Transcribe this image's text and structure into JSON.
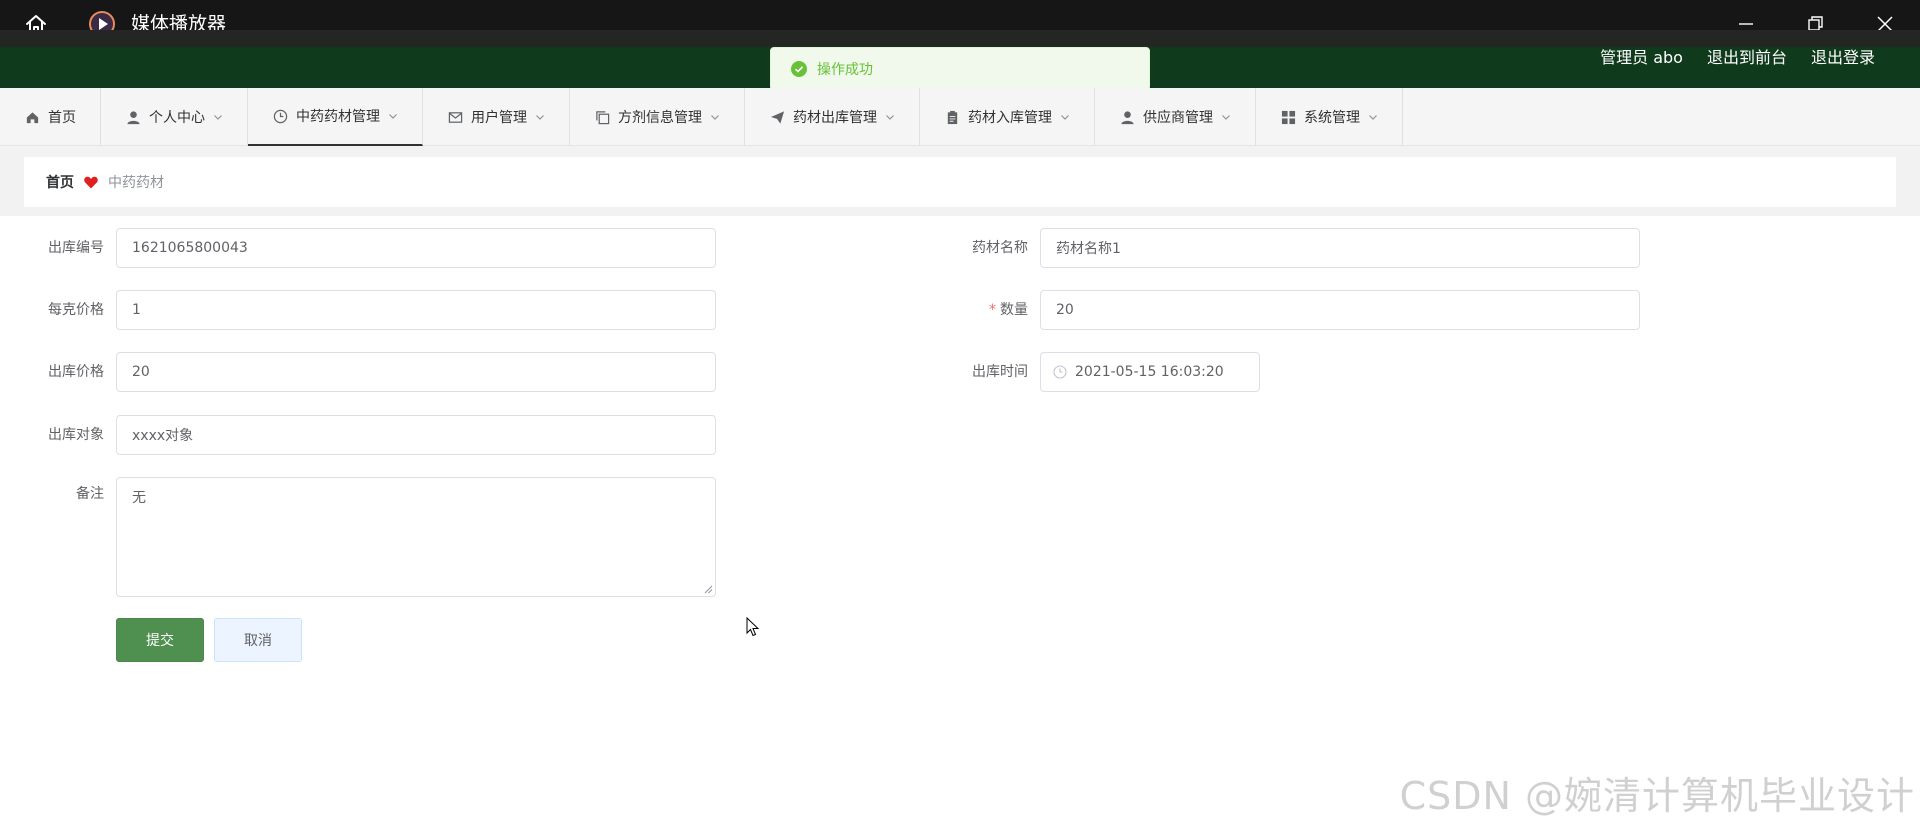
{
  "window": {
    "title": "媒体播放器"
  },
  "header": {
    "user_label": "管理员 abo",
    "to_front": "退出到前台",
    "logout": "退出登录"
  },
  "toast": {
    "message": "操作成功",
    "color": "#67c23a"
  },
  "nav": {
    "items": [
      {
        "label": "首页",
        "icon": "home-icon"
      },
      {
        "label": "个人中心",
        "icon": "user-icon"
      },
      {
        "label": "中药药材管理",
        "icon": "clock-icon"
      },
      {
        "label": "用户管理",
        "icon": "mail-icon"
      },
      {
        "label": "方剂信息管理",
        "icon": "copy-icon"
      },
      {
        "label": "药材出库管理",
        "icon": "send-icon"
      },
      {
        "label": "药材入库管理",
        "icon": "clipboard-icon"
      },
      {
        "label": "供应商管理",
        "icon": "user-icon"
      },
      {
        "label": "系统管理",
        "icon": "grid-icon"
      }
    ],
    "active": "中药药材管理"
  },
  "breadcrumb": {
    "home": "首页",
    "current": "中药药材"
  },
  "form": {
    "out_no_label": "出库编号",
    "out_no_value": "1621065800043",
    "herb_name_label": "药材名称",
    "herb_name_value": "药材名称1",
    "price_per_gram_label": "每克价格",
    "price_per_gram_value": "1",
    "quantity_label": "数量",
    "quantity_required_mark": "*",
    "quantity_value": "20",
    "out_price_label": "出库价格",
    "out_price_value": "20",
    "out_time_label": "出库时间",
    "out_time_value": "2021-05-15 16:03:20",
    "out_target_label": "出库对象",
    "out_target_value": "xxxx对象",
    "remark_label": "备注",
    "remark_value": "无",
    "submit_label": "提交",
    "cancel_label": "取消"
  },
  "watermark": "CSDN @婉清计算机毕业设计",
  "colors": {
    "header_green": "#0f3a1c",
    "submit_green": "#4f8f4f",
    "required_red": "#f56c6c"
  }
}
